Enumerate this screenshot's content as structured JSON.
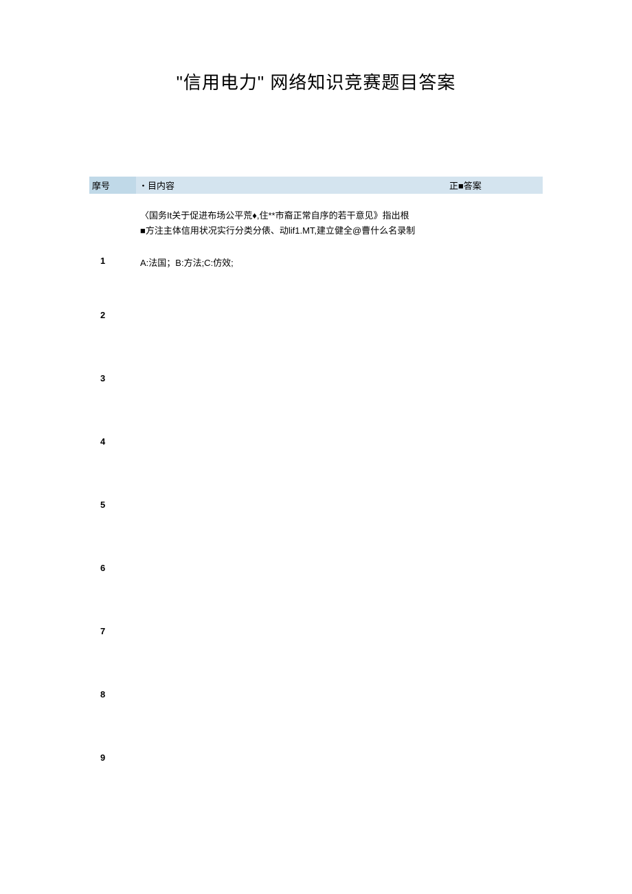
{
  "title": "\"信用电力\"  网络知识竞赛题目答案",
  "headers": {
    "seq": "摩号",
    "content": "・目内容",
    "answer": "正■答案"
  },
  "rows": [
    {
      "seq": "1",
      "content_line1": "〈国务It关于促进布场公平荒♦,住**市裔正常自序的若干意见》指出根",
      "content_line2": "■方注主体信用状况实行分类分俵、动lif1.MT,建立健全@曹什么名录制",
      "content_line3": "A:法国；B:方法;C:仿效;",
      "answer": ""
    },
    {
      "seq": "2",
      "content_line1": "",
      "content_line2": "",
      "content_line3": "",
      "answer": ""
    },
    {
      "seq": "3",
      "content_line1": "",
      "content_line2": "",
      "content_line3": "",
      "answer": ""
    },
    {
      "seq": "4",
      "content_line1": "",
      "content_line2": "",
      "content_line3": "",
      "answer": ""
    },
    {
      "seq": "5",
      "content_line1": "",
      "content_line2": "",
      "content_line3": "",
      "answer": ""
    },
    {
      "seq": "6",
      "content_line1": "",
      "content_line2": "",
      "content_line3": "",
      "answer": ""
    },
    {
      "seq": "7",
      "content_line1": "",
      "content_line2": "",
      "content_line3": "",
      "answer": ""
    },
    {
      "seq": "8",
      "content_line1": "",
      "content_line2": "",
      "content_line3": "",
      "answer": ""
    },
    {
      "seq": "9",
      "content_line1": "",
      "content_line2": "",
      "content_line3": "",
      "answer": ""
    }
  ]
}
